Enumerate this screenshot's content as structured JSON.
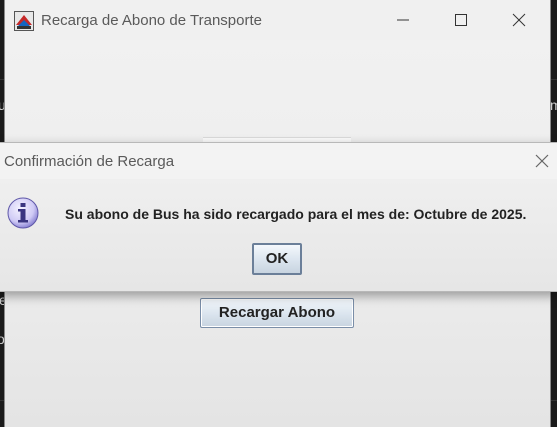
{
  "background": {
    "fragments": [
      "u",
      "m",
      "e",
      "o"
    ]
  },
  "main_window": {
    "title": "Recarga de Abono de Transporte",
    "controls": [
      "minimize",
      "maximize",
      "close"
    ],
    "recharge_button_label": "Recargar Abono"
  },
  "dialog": {
    "title": "Confirmación de Recarga",
    "icon": "info-icon",
    "message": "Su abono de Bus ha sido recargado para el mes de: Octubre de 2025.",
    "ok_label": "OK"
  },
  "colors": {
    "button_border": "#7a8ea8",
    "info_icon": "#7b74c8"
  }
}
